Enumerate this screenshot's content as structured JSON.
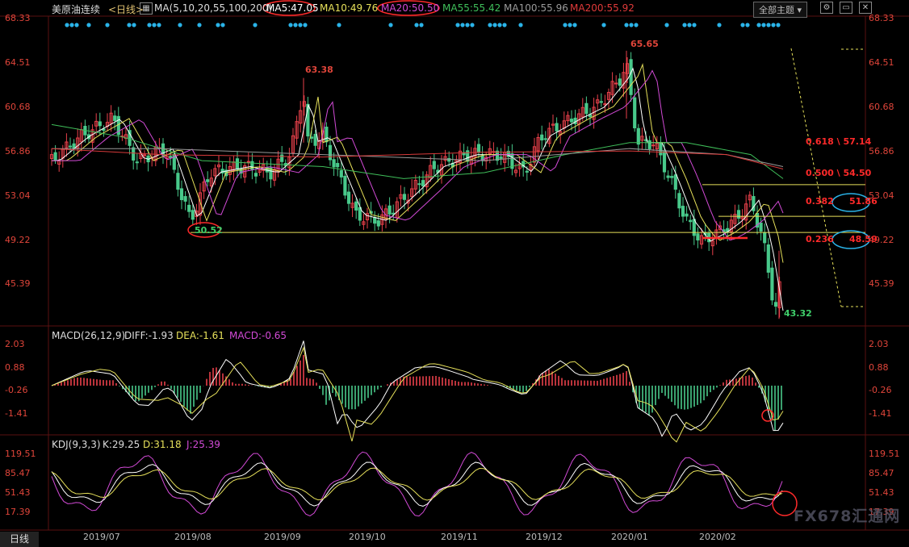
{
  "header": {
    "symbol": "美原油连续",
    "period": "<日线>",
    "ma_label": "MA(5,10,20,55,100,200)",
    "ma5": "MA5:47.05",
    "ma10": "MA10:49.76",
    "ma20": "MA20:50.50",
    "ma55": "MA55:55.42",
    "ma100": "MA100:55.96",
    "ma200": "MA200:55.92",
    "theme_button": "全部主题"
  },
  "price_axis": [
    "68.33",
    "64.51",
    "60.68",
    "56.86",
    "53.04",
    "49.22",
    "45.39"
  ],
  "annotations": {
    "high1": "63.38",
    "high2": "65.65",
    "low1": "50.52",
    "low2": "43.32"
  },
  "fib_levels": [
    {
      "ratio": "0.618",
      "value": "57.14"
    },
    {
      "ratio": "0.500",
      "value": "54.50"
    },
    {
      "ratio": "0.382",
      "value": "51.86"
    },
    {
      "ratio": "0.236",
      "value": "48.59"
    }
  ],
  "macd": {
    "label": "MACD(26,12,9)",
    "diff": "DIFF:-1.93",
    "dea": "DEA:-1.61",
    "macd": "MACD:-0.65",
    "axis": [
      "2.03",
      "0.88",
      "-0.26",
      "-1.41"
    ]
  },
  "kdj": {
    "label": "KDJ(9,3,3)",
    "k": "K:29.25",
    "d": "D:31.18",
    "j": "J:25.39",
    "axis": [
      "119.51",
      "85.47",
      "51.43",
      "17.39"
    ]
  },
  "x_axis": [
    "2019/07",
    "2019/08",
    "2019/09",
    "2019/10",
    "2019/11",
    "2019/12",
    "2020/01",
    "2020/02"
  ],
  "period_tab": "日线",
  "watermark": "FX678汇通网",
  "colors": {
    "up": "#e8404a",
    "down": "#48c98a",
    "ma5": "#ffffff",
    "ma10": "#e6e05a",
    "ma20": "#d24ad6",
    "ma55": "#3fbf5a",
    "ma100": "#9a9a9a",
    "ma200": "#d83a3a",
    "accent_red": "#ff2a2a",
    "accent_blue": "#2ab3e8"
  }
}
